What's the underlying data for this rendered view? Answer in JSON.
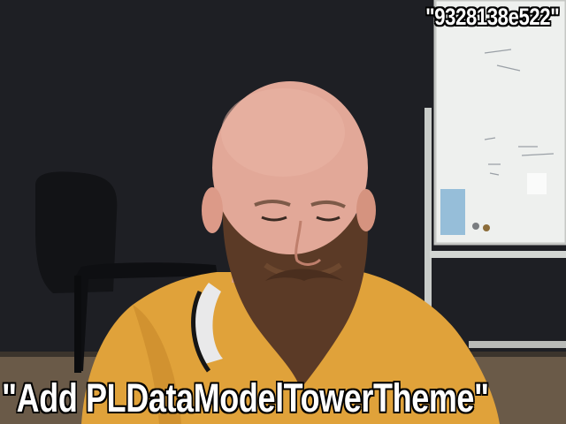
{
  "frame": {
    "overlay_top_right": "\"9328138e522\"",
    "overlay_bottom": "\"Add PLDataModelTowerTheme\""
  },
  "scene": {
    "subject": "bald-bearded-man",
    "shirt_color": "#e0a23a",
    "wall_color": "#1e1f24",
    "whiteboard_color": "#eef0ee"
  }
}
